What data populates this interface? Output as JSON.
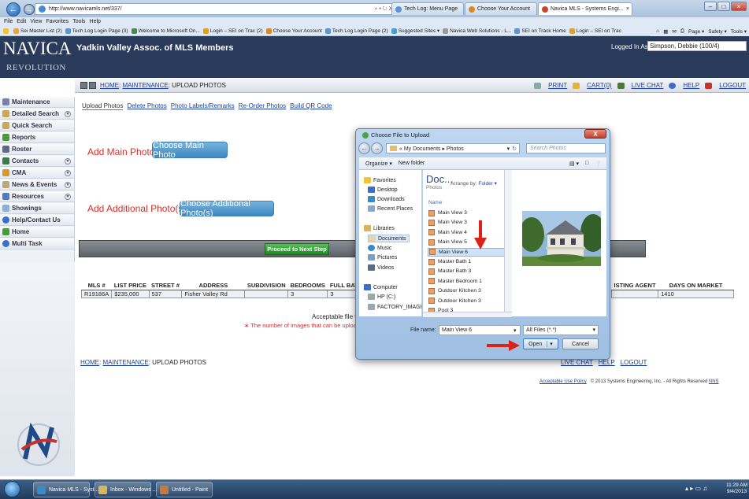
{
  "browser": {
    "url": "http://www.navicamls.net/337/",
    "url_search_hint": "⌕ • ↻ ✕",
    "tabs": [
      "Tech Log: Menu Page",
      "Choose Your Account",
      "Navica MLS - Systems Engi..."
    ],
    "menu": [
      "File",
      "Edit",
      "View",
      "Favorites",
      "Tools",
      "Help"
    ],
    "favorites": [
      "Sei Master List (2)",
      "Tech Log Login Page (3)",
      "Welcome to Microsoft On...",
      "Login – SEI on Trac (2)",
      "Choose Your Account",
      "Tech Log Login Page (2)",
      "Suggested Sites ▾",
      "Navica Web Solutions - L...",
      "SEI on Track Home",
      "Login – SEI on Trac"
    ],
    "toolbar_right": [
      "Page ▾",
      "Safety ▾",
      "Tools ▾"
    ]
  },
  "site": {
    "logo_main": "NAVICA",
    "logo_sub": "REVOLUTION",
    "association": "Yadkin Valley Assoc. of MLS Members",
    "logged_in_label": "Logged In As:",
    "logged_in_user": "Simpson, Debbie (100/4)",
    "breadcrumb": {
      "home": "HOME",
      "maintenance": "MAINTENANCE",
      "current": "UPLOAD PHOTOS",
      "sep": ":"
    },
    "header_links": [
      "PRINT",
      "CART(0)",
      "LIVE CHAT",
      "HELP",
      "LOGOUT"
    ]
  },
  "sidebar": {
    "items": [
      {
        "label": "Maintenance",
        "expander": ""
      },
      {
        "label": "Detailed Search",
        "expander": "▾"
      },
      {
        "label": "Quick Search",
        "expander": ""
      },
      {
        "label": "Reports",
        "expander": ""
      },
      {
        "label": "Roster",
        "expander": ""
      },
      {
        "label": "Contacts",
        "expander": "▾"
      },
      {
        "label": "CMA",
        "expander": "▾"
      },
      {
        "label": "News & Events",
        "expander": "▾"
      },
      {
        "label": "Resources",
        "expander": "▾"
      },
      {
        "label": "Showings",
        "expander": ""
      },
      {
        "label": "Help/Contact Us",
        "expander": ""
      },
      {
        "label": "Home",
        "expander": ""
      },
      {
        "label": "Multi Task",
        "expander": ""
      }
    ]
  },
  "subtabs": [
    "Upload Photos",
    "Delete Photos",
    "Photo Labels/Remarks",
    "Re-Order Photos",
    "Build QR Code"
  ],
  "main": {
    "add_main_label": "Add Main Photo:",
    "choose_main_btn": "Choose Main Photo",
    "add_additional_label": "Add Additional Photo(s):",
    "choose_additional_btn": "Choose Additional Photo(s)",
    "proceed_btn": "Proceed to Next Step",
    "table_headers_left": [
      "MLS #",
      "LIST PRICE",
      "STREET #",
      "ADDRESS",
      "SUBDIVISION",
      "BEDROOMS",
      "FULL BAT"
    ],
    "table_headers_right": [
      "ISTING AGENT",
      "DAYS ON MARKET"
    ],
    "table_row_left": [
      "R19186A",
      "$235,000",
      "537",
      "Fisher Valley Rd",
      "",
      "3",
      "3"
    ],
    "table_row_right": [
      "",
      "1410"
    ],
    "accepted_text": "Acceptable file type",
    "max_note": "∗ The number of images that can be uploaded",
    "footer_links": [
      "LIVE CHAT",
      "HELP",
      "LOGOUT"
    ],
    "acceptable_use": "Acceptable Use Policy",
    "copyright": "© 2013 Systems Engineering, Inc. - All Rights Reserved",
    "copyright_link": "NNS"
  },
  "dialog": {
    "title": "Choose File to Upload",
    "path": "« My Documents ▸ Photos",
    "search_placeholder": "Search Photos",
    "organize": "Organize ▾",
    "new_folder": "New folder",
    "nav_items": [
      "Favorites",
      "Desktop",
      "Downloads",
      "Recent Places",
      "Libraries",
      "Documents",
      "Music",
      "Pictures",
      "Videos",
      "Computer",
      "HP (C:)",
      "FACTORY_IMAGI"
    ],
    "lib_header": "Doc...",
    "lib_sub": "Photos",
    "arrange_by": "Arrange by:",
    "arrange_val": "Folder ▾",
    "col_name": "Name",
    "files": [
      "Main View 3",
      "Main View 3",
      "Main View 4",
      "Main View 5",
      "Main View 6",
      "Master Bath 1",
      "Master Bath 3",
      "Master Bedroom 1",
      "Outdoor Kitchen 3",
      "Outdoor Kitchen 3",
      "Pool 3"
    ],
    "selected_index": 4,
    "filename_label": "File name:",
    "filename_value": "Main View 6",
    "filetype_value": "All Files (*.*)",
    "open_btn": "Open",
    "cancel_btn": "Cancel",
    "close_btn": "X"
  },
  "taskbar": {
    "items": [
      "Navica MLS - Syst...",
      "Inbox - Windows ...",
      "Untitled - Paint"
    ],
    "time": "11:29 AM",
    "date": "9/4/2013"
  },
  "colors": {
    "header_bg": "#2a3a5a",
    "accent_red": "#d6302a",
    "button_blue": "#4a92c8",
    "proceed_green": "#2e9a33"
  }
}
